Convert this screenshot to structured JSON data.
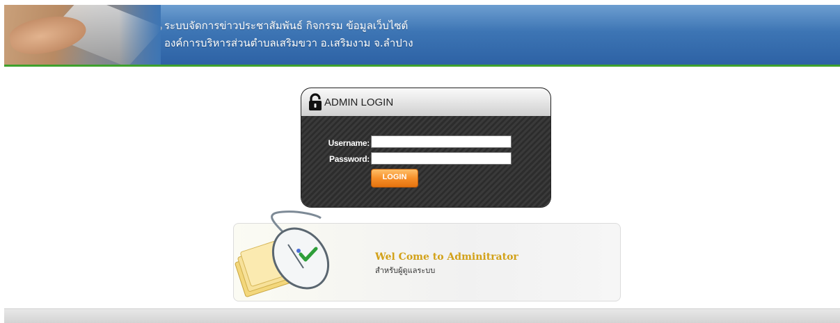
{
  "header": {
    "title_line1": "ระบบจัดการข่าวประชาสัมพันธ์ กิจกรรม ข้อมูลเว็บไซต์",
    "title_line2": "องค์การบริหารส่วนตำบลเสริมขวา อ.เสริมงาม จ.ลำปาง",
    "accent_color": "#3ea12d"
  },
  "login": {
    "title": "ADMIN LOGIN",
    "username_label": "Username:",
    "password_label": "Password:",
    "username_value": "",
    "password_value": "",
    "button_label": "LOGIN",
    "icon": "lock-icon"
  },
  "welcome": {
    "heading": "Wel Come to Adminitrator",
    "subtext": "สำหรับผู้ดูแลระบบ",
    "icon": "mouse-folder-icon"
  }
}
